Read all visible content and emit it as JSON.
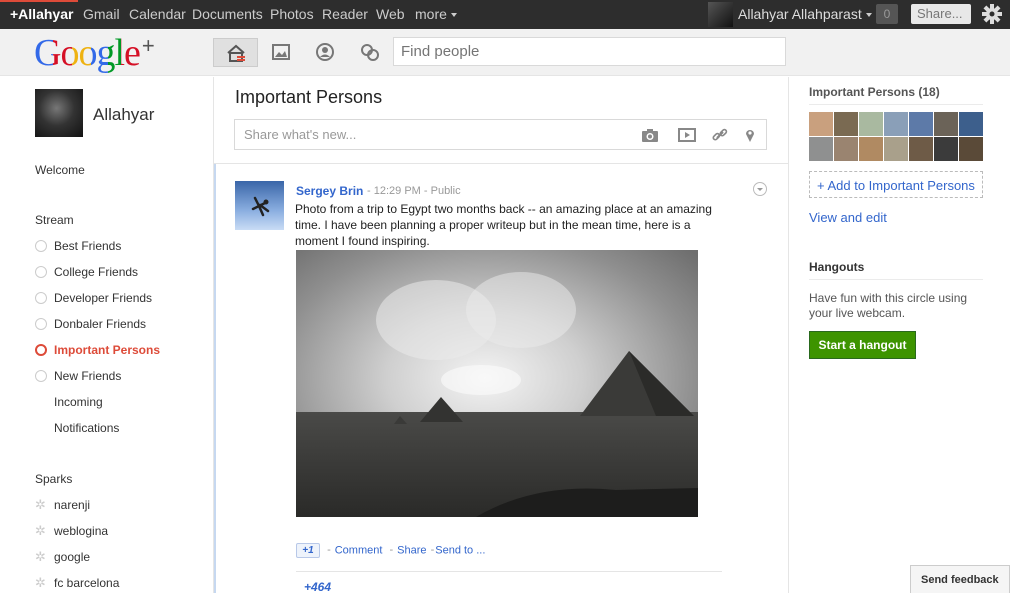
{
  "topbar": {
    "me": "+Allahyar",
    "links": [
      "Gmail",
      "Calendar",
      "Documents",
      "Photos",
      "Reader",
      "Web",
      "more"
    ],
    "user_name": "Allahyar Allahparast",
    "notifications": "0",
    "share": "Share..."
  },
  "header": {
    "logo": "Google",
    "logo_plus": "+",
    "search_placeholder": "Find people"
  },
  "left": {
    "name": "Allahyar",
    "welcome": "Welcome",
    "stream_title": "Stream",
    "circles": [
      "Best Friends",
      "College Friends",
      "Developer Friends",
      "Donbaler Friends",
      "Important Persons",
      "New Friends"
    ],
    "incoming": "Incoming",
    "notifications": "Notifications",
    "sparks_title": "Sparks",
    "sparks": [
      "narenji",
      "weblogina",
      "google",
      "fc barcelona"
    ]
  },
  "main": {
    "title": "Important Persons",
    "share_placeholder": "Share what's new...",
    "post": {
      "author": "Sergey Brin",
      "time": "12:29 PM",
      "visibility": "Public",
      "text": "Photo from a trip to Egypt two months back -- an amazing place at an amazing time. I have been planning a proper writeup but in the mean time, here is a moment I found inspiring.",
      "plus1": "+1",
      "comment": "Comment",
      "share": "Share",
      "send_to": "Send to ...",
      "plus_count": "+464"
    }
  },
  "right": {
    "important_title": "Important Persons (18)",
    "add_label": "+ Add to Important Persons",
    "view_edit": "View and edit",
    "hangouts_title": "Hangouts",
    "hangouts_text": "Have fun with this circle using your live webcam.",
    "hangout_button": "Start a hangout"
  },
  "feedback": "Send feedback",
  "colors": {
    "topbar_bg": "#2d2d2d",
    "accent_red": "#dd4b39",
    "link_blue": "#3366cc",
    "hangout_green": "#3d9400"
  }
}
